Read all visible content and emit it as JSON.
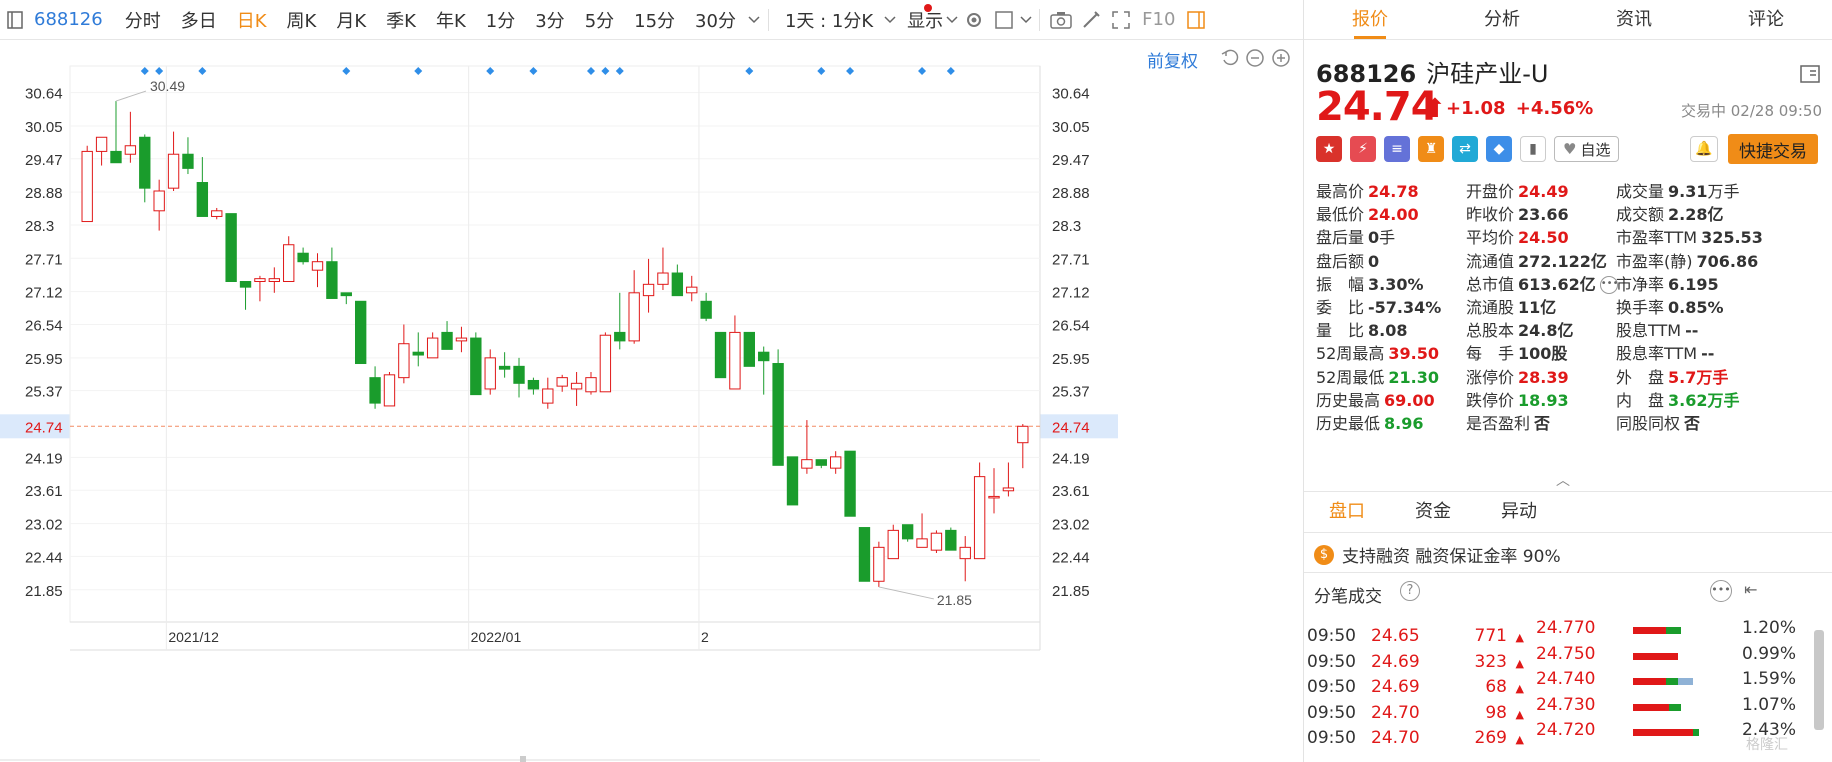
{
  "toolbar": {
    "code": "688126",
    "periods": [
      "分时",
      "多日",
      "日K",
      "周K",
      "月K",
      "季K",
      "年K",
      "1分",
      "3分",
      "5分",
      "15分",
      "30分"
    ],
    "active_period": "日K",
    "interval_select": "1天 : 1分K",
    "display_label": "显示",
    "f10_label": "F10",
    "fuquan_label": "前复权"
  },
  "chart_data": {
    "type": "candlestick",
    "y_ticks": [
      30.64,
      30.05,
      29.47,
      28.88,
      28.3,
      27.71,
      27.12,
      26.54,
      25.95,
      25.37,
      24.74,
      24.19,
      23.61,
      23.02,
      22.44,
      21.85
    ],
    "ylim": [
      21.28,
      31.11
    ],
    "current_price": 24.74,
    "x_labels": [
      "2021/12",
      "2022/01",
      "2"
    ],
    "high_marker": "30.49",
    "low_marker": "21.85",
    "colors": {
      "up": "#e01818",
      "down": "#1a9c2c",
      "dash": "#f28b63",
      "marker": "#2f8ee8"
    },
    "candles": [
      {
        "o": 28.36,
        "h": 29.7,
        "l": 28.36,
        "c": 29.6
      },
      {
        "o": 29.6,
        "h": 29.8,
        "l": 29.35,
        "c": 29.85
      },
      {
        "o": 29.6,
        "h": 30.49,
        "l": 29.4,
        "c": 29.4
      },
      {
        "o": 29.55,
        "h": 30.3,
        "l": 29.4,
        "c": 29.7
      },
      {
        "o": 29.85,
        "h": 29.9,
        "l": 28.7,
        "c": 28.95
      },
      {
        "o": 28.55,
        "h": 29.1,
        "l": 28.2,
        "c": 28.9
      },
      {
        "o": 28.95,
        "h": 29.95,
        "l": 28.9,
        "c": 29.55
      },
      {
        "o": 29.55,
        "h": 29.85,
        "l": 29.2,
        "c": 29.3
      },
      {
        "o": 29.05,
        "h": 29.5,
        "l": 28.45,
        "c": 28.45
      },
      {
        "o": 28.45,
        "h": 28.6,
        "l": 28.4,
        "c": 28.55
      },
      {
        "o": 28.5,
        "h": 28.5,
        "l": 27.3,
        "c": 27.3
      },
      {
        "o": 27.3,
        "h": 27.3,
        "l": 26.8,
        "c": 27.2
      },
      {
        "o": 27.3,
        "h": 27.4,
        "l": 26.95,
        "c": 27.35
      },
      {
        "o": 27.3,
        "h": 27.55,
        "l": 27.1,
        "c": 27.35
      },
      {
        "o": 27.3,
        "h": 28.1,
        "l": 27.3,
        "c": 27.95
      },
      {
        "o": 27.8,
        "h": 27.9,
        "l": 27.6,
        "c": 27.65
      },
      {
        "o": 27.5,
        "h": 27.8,
        "l": 27.2,
        "c": 27.65
      },
      {
        "o": 27.65,
        "h": 27.9,
        "l": 27.0,
        "c": 27.0
      },
      {
        "o": 27.1,
        "h": 27.1,
        "l": 26.9,
        "c": 27.05
      },
      {
        "o": 26.95,
        "h": 26.95,
        "l": 25.85,
        "c": 25.85
      },
      {
        "o": 25.6,
        "h": 25.8,
        "l": 25.05,
        "c": 25.15
      },
      {
        "o": 25.1,
        "h": 25.7,
        "l": 25.1,
        "c": 25.65
      },
      {
        "o": 25.6,
        "h": 26.54,
        "l": 25.5,
        "c": 26.2
      },
      {
        "o": 26.05,
        "h": 26.4,
        "l": 25.8,
        "c": 26.0
      },
      {
        "o": 25.95,
        "h": 26.4,
        "l": 25.95,
        "c": 26.3
      },
      {
        "o": 26.4,
        "h": 26.6,
        "l": 26.2,
        "c": 26.1
      },
      {
        "o": 26.25,
        "h": 26.5,
        "l": 26.05,
        "c": 26.3
      },
      {
        "o": 26.3,
        "h": 26.4,
        "l": 25.9,
        "c": 25.3
      },
      {
        "o": 25.4,
        "h": 26.1,
        "l": 25.3,
        "c": 25.95
      },
      {
        "o": 25.8,
        "h": 26.05,
        "l": 25.6,
        "c": 25.75
      },
      {
        "o": 25.8,
        "h": 25.95,
        "l": 25.25,
        "c": 25.5
      },
      {
        "o": 25.55,
        "h": 25.6,
        "l": 25.3,
        "c": 25.4
      },
      {
        "o": 25.15,
        "h": 25.6,
        "l": 25.05,
        "c": 25.4
      },
      {
        "o": 25.45,
        "h": 25.65,
        "l": 25.35,
        "c": 25.6
      },
      {
        "o": 25.4,
        "h": 25.7,
        "l": 25.1,
        "c": 25.5
      },
      {
        "o": 25.35,
        "h": 25.7,
        "l": 25.3,
        "c": 25.6
      },
      {
        "o": 25.35,
        "h": 26.4,
        "l": 25.35,
        "c": 26.35
      },
      {
        "o": 26.4,
        "h": 27.1,
        "l": 26.1,
        "c": 26.25
      },
      {
        "o": 26.25,
        "h": 27.5,
        "l": 26.2,
        "c": 27.1
      },
      {
        "o": 27.05,
        "h": 27.7,
        "l": 26.75,
        "c": 27.25
      },
      {
        "o": 27.25,
        "h": 27.9,
        "l": 27.15,
        "c": 27.45
      },
      {
        "o": 27.45,
        "h": 27.6,
        "l": 27.1,
        "c": 27.05
      },
      {
        "o": 27.1,
        "h": 27.4,
        "l": 26.95,
        "c": 27.2
      },
      {
        "o": 26.95,
        "h": 27.1,
        "l": 26.6,
        "c": 26.65
      },
      {
        "o": 26.4,
        "h": 26.4,
        "l": 25.6,
        "c": 25.6
      },
      {
        "o": 25.4,
        "h": 26.7,
        "l": 25.4,
        "c": 26.4
      },
      {
        "o": 26.4,
        "h": 26.4,
        "l": 25.8,
        "c": 25.8
      },
      {
        "o": 26.05,
        "h": 26.15,
        "l": 25.3,
        "c": 25.9
      },
      {
        "o": 25.85,
        "h": 26.1,
        "l": 24.05,
        "c": 24.05
      },
      {
        "o": 24.2,
        "h": 24.2,
        "l": 23.35,
        "c": 23.35
      },
      {
        "o": 24.0,
        "h": 24.85,
        "l": 23.9,
        "c": 24.15
      },
      {
        "o": 24.15,
        "h": 24.15,
        "l": 24.0,
        "c": 24.05
      },
      {
        "o": 24.0,
        "h": 24.3,
        "l": 23.9,
        "c": 24.2
      },
      {
        "o": 24.3,
        "h": 24.3,
        "l": 23.15,
        "c": 23.15
      },
      {
        "o": 22.95,
        "h": 22.95,
        "l": 22.0,
        "c": 22.0
      },
      {
        "o": 22.0,
        "h": 22.7,
        "l": 21.9,
        "c": 22.6
      },
      {
        "o": 22.4,
        "h": 23.0,
        "l": 22.4,
        "c": 22.9
      },
      {
        "o": 23.0,
        "h": 23.0,
        "l": 22.7,
        "c": 22.75
      },
      {
        "o": 22.6,
        "h": 23.2,
        "l": 22.6,
        "c": 22.75
      },
      {
        "o": 22.55,
        "h": 22.9,
        "l": 22.5,
        "c": 22.85
      },
      {
        "o": 22.9,
        "h": 22.95,
        "l": 22.55,
        "c": 22.55
      },
      {
        "o": 22.4,
        "h": 22.8,
        "l": 22.0,
        "c": 22.6
      },
      {
        "o": 22.4,
        "h": 24.1,
        "l": 22.4,
        "c": 23.85
      },
      {
        "o": 23.5,
        "h": 24.0,
        "l": 23.2,
        "c": 23.5
      },
      {
        "o": 23.6,
        "h": 24.1,
        "l": 23.5,
        "c": 23.65
      },
      {
        "o": 24.45,
        "h": 24.78,
        "l": 24.0,
        "c": 24.74
      }
    ],
    "event_markers_at": [
      4,
      5,
      8,
      18,
      23,
      28,
      31,
      35,
      36,
      37,
      46,
      51,
      53,
      58,
      60
    ]
  },
  "panel": {
    "tabs": [
      "报价",
      "分析",
      "资讯",
      "评论"
    ],
    "active_tab": "报价",
    "code": "688126",
    "name": "沪硅产业-U",
    "price": "24.74",
    "arrow": "⬆",
    "change": "+1.08",
    "change_pct": "+4.56%",
    "status": "交易中 02/28 09:50",
    "zixuan": "自选",
    "quick_trade": "快捷交易",
    "quotes": [
      [
        [
          "最高价",
          "24.78",
          "up",
          ""
        ],
        [
          "开盘价",
          "24.49",
          "up",
          ""
        ],
        [
          "成交量",
          "9.31",
          "",
          "万手"
        ]
      ],
      [
        [
          "最低价",
          "24.00",
          "up",
          ""
        ],
        [
          "昨收价",
          "23.66",
          "",
          ""
        ],
        [
          "成交额",
          "2.28亿",
          "",
          ""
        ]
      ],
      [
        [
          "盘后量",
          "0",
          "",
          "手"
        ],
        [
          "平均价",
          "24.50",
          "up",
          ""
        ],
        [
          "市盈率TTM",
          "325.53",
          "",
          ""
        ]
      ],
      [
        [
          "盘后额",
          "0",
          "",
          ""
        ],
        [
          "流通值",
          "272.122亿",
          "",
          ""
        ],
        [
          "市盈率(静)",
          "706.86",
          "",
          ""
        ]
      ],
      [
        [
          "振　幅",
          "3.30%",
          "",
          ""
        ],
        [
          "总市值",
          "613.62亿",
          "",
          ""
        ],
        [
          "市净率",
          "6.195",
          "",
          ""
        ]
      ],
      [
        [
          "委　比",
          "-57.34%",
          "",
          ""
        ],
        [
          "流通股",
          "11亿",
          "",
          ""
        ],
        [
          "换手率",
          "0.85%",
          "",
          ""
        ]
      ],
      [
        [
          "量　比",
          "8.08",
          "",
          ""
        ],
        [
          "总股本",
          "24.8亿",
          "",
          ""
        ],
        [
          "股息TTM",
          "--",
          "",
          ""
        ]
      ],
      [
        [
          "52周最高",
          "39.50",
          "up",
          ""
        ],
        [
          "每　手",
          "100股",
          "",
          ""
        ],
        [
          "股息率TTM",
          "--",
          "",
          ""
        ]
      ],
      [
        [
          "52周最低",
          "21.30",
          "dn",
          ""
        ],
        [
          "涨停价",
          "28.39",
          "up",
          ""
        ],
        [
          "外　盘",
          "5.7万手",
          "up",
          ""
        ]
      ],
      [
        [
          "历史最高",
          "69.00",
          "up",
          ""
        ],
        [
          "跌停价",
          "18.93",
          "dn",
          ""
        ],
        [
          "内　盘",
          "3.62万手",
          "dn",
          ""
        ]
      ],
      [
        [
          "历史最低",
          "8.96",
          "dn",
          ""
        ],
        [
          "是否盈利",
          "否",
          "",
          ""
        ],
        [
          "同股同权",
          "否",
          "",
          ""
        ]
      ]
    ],
    "subtabs": [
      "盘口",
      "资金",
      "异动"
    ],
    "active_subtab": "盘口",
    "margin_text": "支持融资 融资保证金率 90%",
    "ticks_title": "分笔成交",
    "ticks": [
      {
        "time": "09:50",
        "price": "24.65",
        "vol": "771"
      },
      {
        "time": "09:50",
        "price": "24.69",
        "vol": "323"
      },
      {
        "time": "09:50",
        "price": "24.69",
        "vol": "68"
      },
      {
        "time": "09:50",
        "price": "24.70",
        "vol": "98"
      },
      {
        "time": "09:50",
        "price": "24.70",
        "vol": "269"
      }
    ],
    "dist": [
      {
        "price": "24.770",
        "pct": "1.20%",
        "bar": [
          0.55,
          0.25,
          0.0
        ]
      },
      {
        "price": "24.750",
        "pct": "0.99%",
        "bar": [
          0.75,
          0.0,
          0.0
        ]
      },
      {
        "price": "24.740",
        "pct": "1.59%",
        "bar": [
          0.55,
          0.2,
          0.25
        ]
      },
      {
        "price": "24.730",
        "pct": "1.07%",
        "bar": [
          0.6,
          0.2,
          0.0
        ]
      },
      {
        "price": "24.720",
        "pct": "2.43%",
        "bar": [
          1.0,
          0.1,
          0.0
        ]
      }
    ],
    "watermark": "格隆汇"
  }
}
